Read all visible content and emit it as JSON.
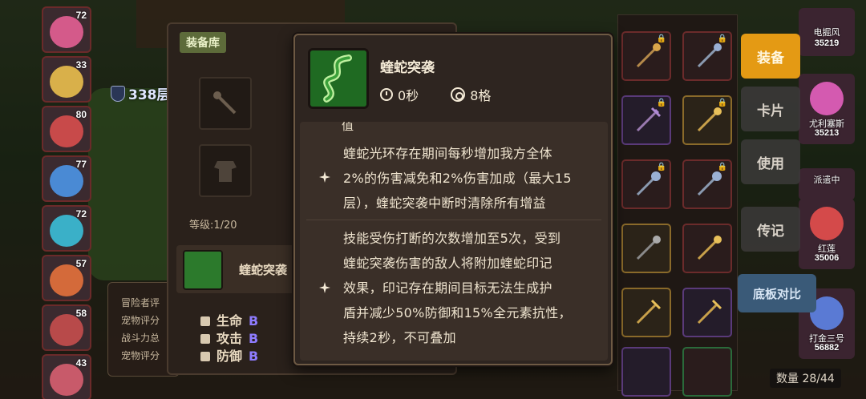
{
  "hero_list": [
    {
      "level": "72",
      "color": "#d45a8a"
    },
    {
      "level": "33",
      "color": "#d9b04a"
    },
    {
      "level": "80",
      "color": "#c84a4a"
    },
    {
      "level": "77",
      "color": "#4a8ad4"
    },
    {
      "level": "72",
      "color": "#3ab0c8"
    },
    {
      "level": "57",
      "color": "#d46a3a"
    },
    {
      "level": "58",
      "color": "#b84a4a"
    },
    {
      "level": "43",
      "color": "#c85a6a"
    }
  ],
  "floor": {
    "label": "338层"
  },
  "stats_panel": {
    "lines": [
      "冒险者评",
      "宠物评分",
      "战斗力总",
      "宠物评分"
    ]
  },
  "equip_panel": {
    "tab_label": "装备库",
    "level_label": "等级:1/20",
    "skill_name": "蝰蛇突袭",
    "attributes": [
      {
        "name": "生命",
        "grade": "B"
      },
      {
        "name": "攻击",
        "grade": "B"
      },
      {
        "name": "防御",
        "grade": "B"
      }
    ]
  },
  "tooltip": {
    "title": "蝰蛇突袭",
    "cooldown": "0秒",
    "range": "8格",
    "clipped_text": "值",
    "descriptions": [
      [
        "蝰蛇光环存在期间每秒增加我方全体",
        "2%的伤害减免和2%伤害加成（最大15",
        "层），蝰蛇突袭中断时清除所有增益"
      ],
      [
        "技能受伤打断的次数增加至5次，受到",
        "蝰蛇突袭伤害的敌人将附加蝰蛇印记",
        "效果，印记存在期间目标无法生成护",
        "盾并减少50%防御和15%全元素抗性，",
        "持续2秒，不可叠加"
      ]
    ]
  },
  "side_buttons": {
    "equip": "装备",
    "card": "卡片",
    "use": "使用",
    "biography": "传记",
    "compare": "底板对比"
  },
  "right_heroes": [
    {
      "name": "电掘风",
      "score": "35219",
      "color": "#8a6ad4"
    },
    {
      "name": "尤利塞斯",
      "score": "35213",
      "color": "#d45ab0"
    },
    {
      "name": "派遣中",
      "score": "",
      "color": "#c84a4a"
    },
    {
      "name": "红莲",
      "score": "35006",
      "color": "#d44a4a"
    },
    {
      "name": "打金三号",
      "score": "56882",
      "color": "#5a7ad4"
    }
  ],
  "count_label": "数量 28/44",
  "colors": {
    "accent": "#e49a14",
    "grade": "#8e7cff",
    "tooltip_border": "#6e5a44"
  }
}
